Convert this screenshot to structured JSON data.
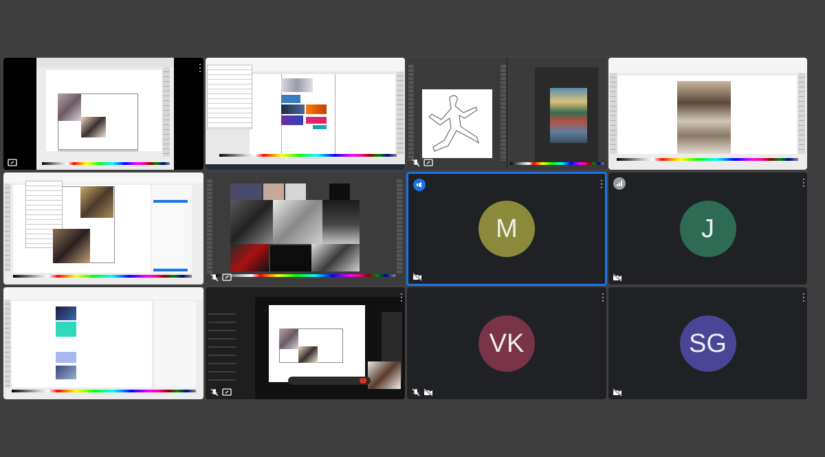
{
  "meeting": {
    "more_glyph": "⋮",
    "participants": [
      {
        "initials": "M",
        "color": "#8a8a3a"
      },
      {
        "initials": "J",
        "color": "#2e6b55"
      },
      {
        "initials": "VK",
        "color": "#7a3448"
      },
      {
        "initials": "SG",
        "color": "#4a4596"
      }
    ]
  },
  "icons": {
    "present": "present-screen-icon",
    "mic_off": "mic-off-icon",
    "cam_off": "camera-off-icon",
    "speaking": "speaking-indicator-icon",
    "signal": "signal-bars-icon"
  },
  "colors": {
    "background": "#404040",
    "tile": "#1f1f1f",
    "active_border": "#1a73e8"
  }
}
